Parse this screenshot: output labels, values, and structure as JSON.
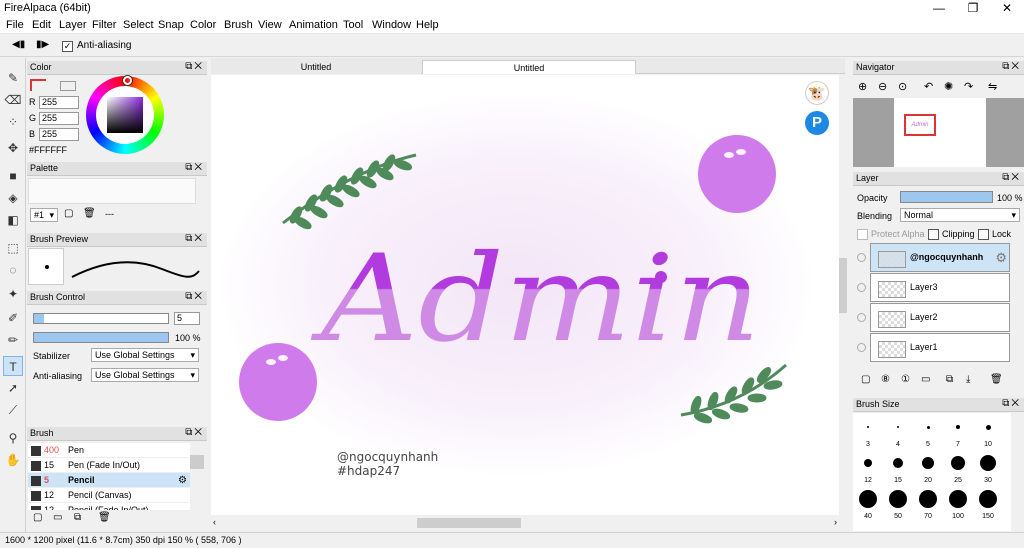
{
  "window": {
    "title": "FireAlpaca (64bit)"
  },
  "menu": [
    "File",
    "Edit",
    "Layer",
    "Filter",
    "Select",
    "Snap",
    "Color",
    "Brush",
    "View",
    "Animation",
    "Tool",
    "Window",
    "Help"
  ],
  "options": {
    "antialias_label": "Anti-aliasing"
  },
  "color_panel": {
    "title": "Color",
    "r_label": "R",
    "g_label": "G",
    "b_label": "B",
    "r": "255",
    "g": "255",
    "b": "255",
    "hex": "#FFFFFF"
  },
  "palette_panel": {
    "title": "Palette",
    "selector": "#1",
    "dash": "---"
  },
  "brush_preview_panel": {
    "title": "Brush Preview"
  },
  "brush_control": {
    "title": "Brush Control",
    "size": "5",
    "opacity": "100 %",
    "stabilizer_label": "Stabilizer",
    "stabilizer_value": "Use Global Settings",
    "antialias_label": "Anti-aliasing",
    "antialias_value": "Use Global Settings"
  },
  "brush_panel": {
    "title": "Brush",
    "items": [
      {
        "num": "400",
        "label": "Pen",
        "num_color": "#d9534f"
      },
      {
        "num": "15",
        "label": "Pen (Fade In/Out)",
        "num_color": "#000"
      },
      {
        "num": "5",
        "label": "Pencil",
        "num_color": "#d9534f",
        "selected": true
      },
      {
        "num": "12",
        "label": "Pencil (Canvas)",
        "num_color": "#000"
      },
      {
        "num": "12",
        "label": "Pencil (Fade In/Out)",
        "num_color": "#000"
      }
    ]
  },
  "tabs": [
    "Untitled",
    "Untitled"
  ],
  "canvas": {
    "title_text": "Admin",
    "credit1": "@ngocquynhanh",
    "credit2": "#hdap247"
  },
  "navigator": {
    "title": "Navigator",
    "thumb_text": "Admin"
  },
  "layer_panel": {
    "title": "Layer",
    "opacity_label": "Opacity",
    "opacity_value": "100 %",
    "blending_label": "Blending",
    "blending_value": "Normal",
    "protect_alpha": "Protect Alpha",
    "clipping": "Clipping",
    "lock": "Lock",
    "layers": [
      "@ngocquynhanh",
      "Layer3",
      "Layer2",
      "Layer1"
    ]
  },
  "brush_size_panel": {
    "title": "Brush Size",
    "sizes": [
      "3",
      "4",
      "5",
      "7",
      "10",
      "12",
      "15",
      "20",
      "25",
      "30",
      "40",
      "50",
      "70",
      "100",
      "150"
    ]
  },
  "status": {
    "text": "1600 * 1200 pixel   (11.6 * 8.7cm)   350 dpi   150 %   ( 558, 706 )"
  },
  "colors": {
    "accent": "#cde4f7",
    "letter_light": "#cf8ae6",
    "letter_dark": "#b23be0",
    "bubble": "#cf7bec",
    "leaf": "#4f8a5b"
  }
}
